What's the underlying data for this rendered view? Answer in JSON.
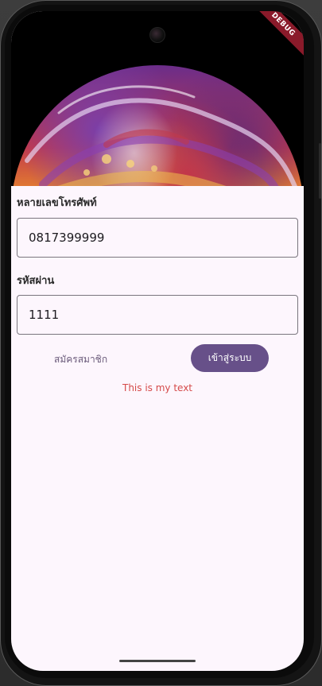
{
  "debug_banner": "DEBUG",
  "phone_label": "หลายเลขโทรศัพท์",
  "phone_value": "0817399999",
  "password_label": "รหัสผ่าน",
  "password_value": "1111",
  "register_label": "สมัครสมาชิก",
  "login_label": "เข้าสู่ระบบ",
  "message_text": "This is my text",
  "colors": {
    "primary": "#675089",
    "background": "#fdf6fd",
    "message": "#d54a4a",
    "text_button": "#6b5b7b"
  },
  "icons": {
    "camera": "front-camera-icon"
  }
}
